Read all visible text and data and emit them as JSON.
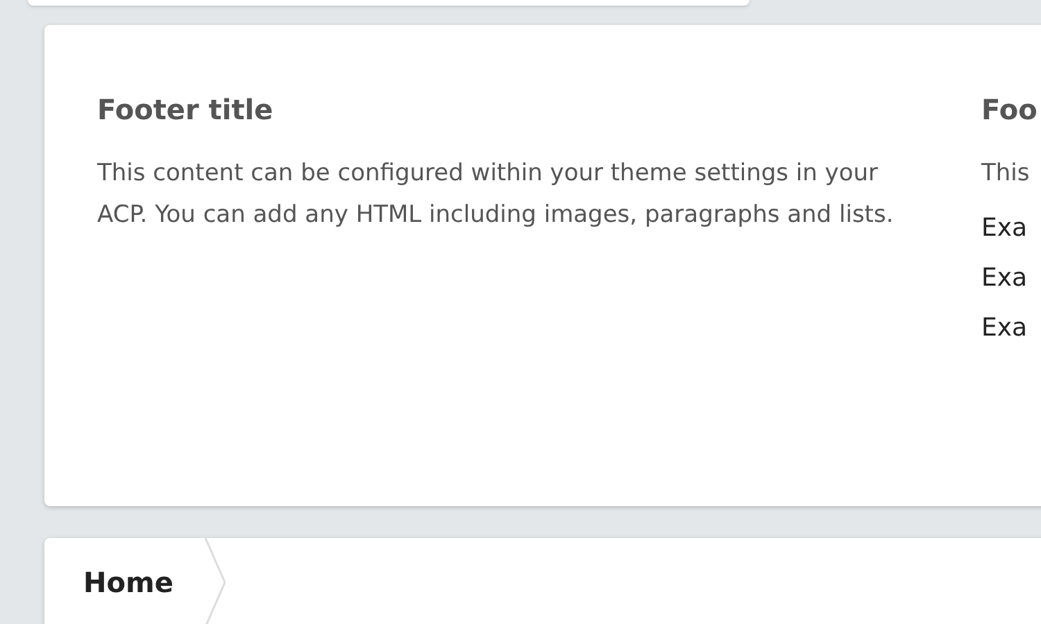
{
  "footer_columns": [
    {
      "title": "Footer title",
      "text": "This content can be configured within your theme settings in your ACP. You can add any HTML including images, paragraphs and lists."
    },
    {
      "title": "Foo",
      "text": "This",
      "list": [
        "Exa",
        "Exa",
        "Exa"
      ]
    }
  ],
  "breadcrumb": [
    {
      "label": "Home"
    }
  ]
}
